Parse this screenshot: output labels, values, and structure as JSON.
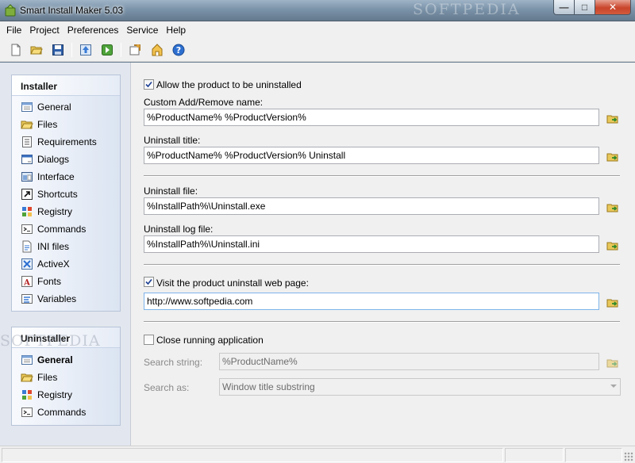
{
  "window": {
    "title": "Smart Install Maker 5.03",
    "watermark": "SOFTPEDIA"
  },
  "menu": [
    "File",
    "Project",
    "Preferences",
    "Service",
    "Help"
  ],
  "toolbar": {
    "icons": [
      "new-file-icon",
      "open-folder-icon",
      "save-icon",
      "build-icon",
      "run-icon",
      "options-icon",
      "update-icon",
      "help-icon"
    ]
  },
  "sidebar": {
    "installer_title": "Installer",
    "installer_items": [
      {
        "label": "General",
        "icon": "general-icon"
      },
      {
        "label": "Files",
        "icon": "files-icon"
      },
      {
        "label": "Requirements",
        "icon": "requirements-icon"
      },
      {
        "label": "Dialogs",
        "icon": "dialogs-icon"
      },
      {
        "label": "Interface",
        "icon": "interface-icon"
      },
      {
        "label": "Shortcuts",
        "icon": "shortcuts-icon"
      },
      {
        "label": "Registry",
        "icon": "registry-icon"
      },
      {
        "label": "Commands",
        "icon": "commands-icon"
      },
      {
        "label": "INI files",
        "icon": "ini-files-icon"
      },
      {
        "label": "ActiveX",
        "icon": "activex-icon"
      },
      {
        "label": "Fonts",
        "icon": "fonts-icon"
      },
      {
        "label": "Variables",
        "icon": "variables-icon"
      }
    ],
    "uninstaller_title": "Uninstaller",
    "uninstaller_items": [
      {
        "label": "General",
        "icon": "general-icon",
        "active": true
      },
      {
        "label": "Files",
        "icon": "files-icon"
      },
      {
        "label": "Registry",
        "icon": "registry-icon"
      },
      {
        "label": "Commands",
        "icon": "commands-icon"
      }
    ],
    "watermark": "SOFTPEDIA"
  },
  "form": {
    "allow_uninstall_label": "Allow the product to be uninstalled",
    "allow_uninstall_checked": true,
    "add_remove_name_label": "Custom Add/Remove name:",
    "add_remove_name_value": "%ProductName% %ProductVersion%",
    "uninstall_title_label": "Uninstall title:",
    "uninstall_title_value": "%ProductName% %ProductVersion% Uninstall",
    "uninstall_file_label": "Uninstall file:",
    "uninstall_file_value": "%InstallPath%\\Uninstall.exe",
    "uninstall_log_label": "Uninstall log file:",
    "uninstall_log_value": "%InstallPath%\\Uninstall.ini",
    "visit_web_label": "Visit the product uninstall web page:",
    "visit_web_checked": true,
    "web_url_value": "http://www.softpedia.com",
    "close_app_label": "Close running application",
    "close_app_checked": false,
    "search_string_label": "Search string:",
    "search_string_value": "%ProductName%",
    "search_as_label": "Search as:",
    "search_as_value": "Window title substring"
  },
  "colors": {
    "accent": "#3a7bd5",
    "panel_border": "#b7c4d8",
    "sidebar_bg": "#e2e6ee"
  }
}
